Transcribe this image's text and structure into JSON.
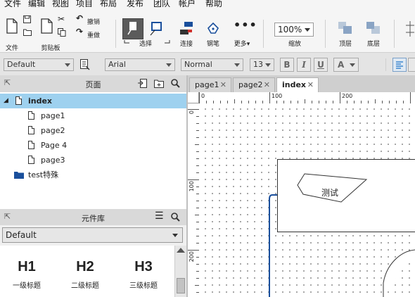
{
  "menu": [
    "文件",
    "编辑",
    "视图",
    "项目",
    "布局",
    "发布",
    "团队",
    "帐户",
    "帮助"
  ],
  "toolbar": {
    "file_label": "文件",
    "clipboard_label": "剪贴板",
    "undo_label": "撤销",
    "redo_label": "重做",
    "select_label": "选择",
    "connect_label": "连接",
    "pen_label": "钢笔",
    "more_label": "更多▾",
    "zoom_value": "100%",
    "zoom_label": "缩放",
    "top_label": "顶层",
    "bottom_label": "底层"
  },
  "format": {
    "style": "Default",
    "font": "Arial",
    "weight": "Normal",
    "size": "13",
    "bold": "B",
    "italic": "I",
    "underline": "U",
    "font_color": "A"
  },
  "pages_panel": {
    "title": "页面",
    "items": [
      {
        "label": "index",
        "selected": true
      },
      {
        "label": "page1"
      },
      {
        "label": "page2"
      },
      {
        "label": "Page 4"
      },
      {
        "label": "page3"
      },
      {
        "label": "test特殊"
      }
    ]
  },
  "library_panel": {
    "title": "元件库",
    "selected": "Default",
    "widgets": [
      {
        "big": "H1",
        "small": "一级标题"
      },
      {
        "big": "H2",
        "small": "二级标题"
      },
      {
        "big": "H3",
        "small": "三级标题"
      }
    ]
  },
  "tabs": [
    {
      "label": "page1",
      "active": false
    },
    {
      "label": "page2",
      "active": false
    },
    {
      "label": "index",
      "active": true
    }
  ],
  "tab_close": "✕",
  "ruler": {
    "top": [
      "0",
      "100",
      "200"
    ],
    "left": [
      "0",
      "100",
      "200"
    ]
  },
  "canvas": {
    "shape_text": "测试"
  },
  "colors": {
    "selection": "#9ed1ef",
    "folder": "#1a4f9c",
    "connector": "#1a4f9c",
    "format_icon": "#1a73c7"
  }
}
